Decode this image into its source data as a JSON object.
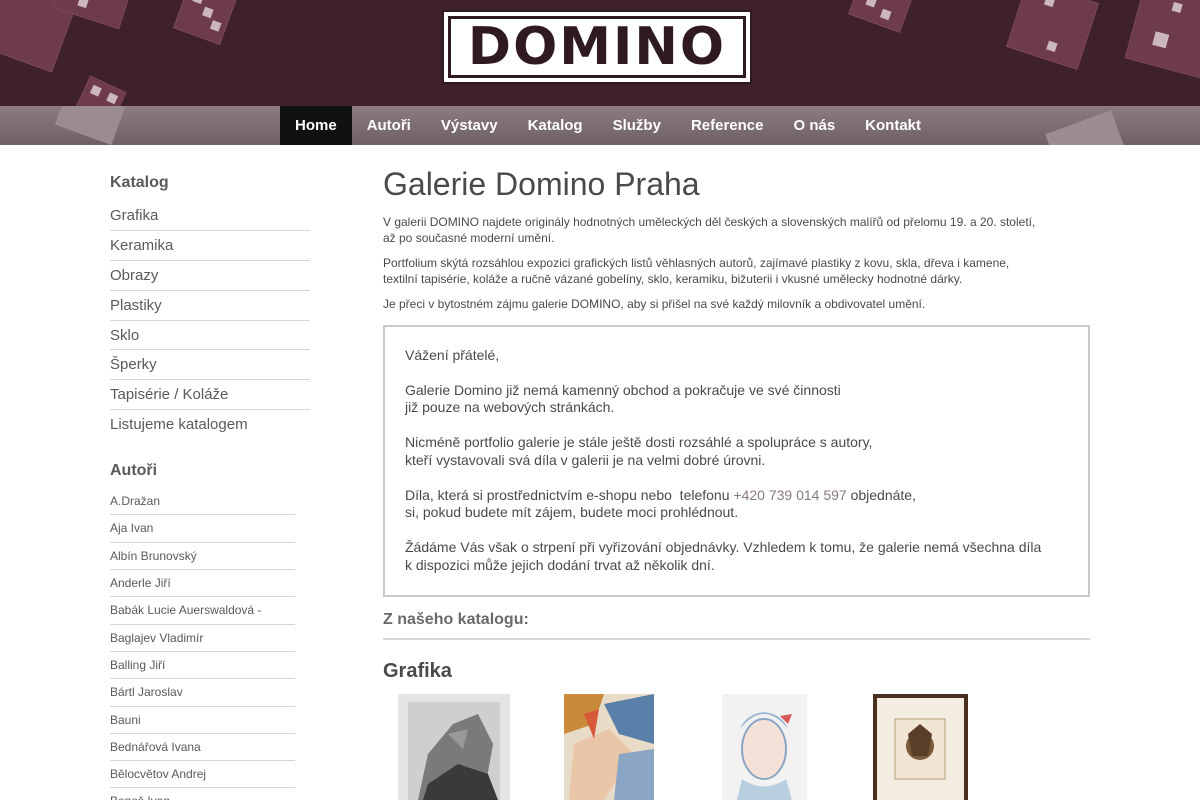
{
  "brand": {
    "logo_text": "DOMINO"
  },
  "nav": {
    "items": [
      {
        "label": "Home",
        "active": true
      },
      {
        "label": "Autoři"
      },
      {
        "label": "Výstavy"
      },
      {
        "label": "Katalog"
      },
      {
        "label": "Služby"
      },
      {
        "label": "Reference"
      },
      {
        "label": "O nás"
      },
      {
        "label": "Kontakt"
      }
    ]
  },
  "sidebar": {
    "catalog_heading": "Katalog",
    "catalog_items": [
      "Grafika",
      "Keramika",
      "Obrazy",
      "Plastiky",
      "Sklo",
      "Šperky",
      "Tapisérie / Koláže",
      "Listujeme katalogem"
    ],
    "authors_heading": "Autoři",
    "authors": [
      "A.Dražan",
      "Aja Ivan",
      "Albín Brunovský",
      "Anderle Jiří",
      "Babák Lucie Auerswaldová -",
      "Baglajev Vladimír",
      "Balling Jiří",
      "Bártl Jaroslav",
      "Bauni",
      "Bednářová Ivana",
      "Bělocvětov Andrej",
      "Beneš Ivan"
    ]
  },
  "main": {
    "title": "Galerie Domino Praha",
    "intro": [
      "V galerii DOMINO najdete originály hodnotných uměleckých děl českých a slovenských malířů od přelomu 19. a 20. století, až po současné moderní umění.",
      "Portfolium skýtá rozsáhlou expozici grafických listů věhlasných autorů, zajímavé plastiky z kovu, skla, dřeva i kamene, textilní tapisérie, koláže a ručně vázané gobelíny, sklo, keramiku, bižuterii i vkusné umělecky hodnotné dárky.",
      "Je přeci v bytostném zájmu galerie DOMINO, aby si přišel na své každý milovník a obdivovatel umění."
    ],
    "notice": {
      "greeting": "Vážení přátelé,",
      "p1_l1": "Galerie Domino již nemá kamenný obchod a pokračuje ve své činnosti",
      "p1_l2": "již pouze na webových stránkách.",
      "p2_l1": "Nicméně portfolio galerie je stále ještě dosti rozsáhlé a spolupráce s autory,",
      "p2_l2": "kteří vystavovali svá díla v galerii je na velmi dobré úrovni.",
      "p3_pre": "Díla, která si prostřednictvím e-shopu nebo  telefonu ",
      "p3_phone": "+420 739 014 597",
      "p3_post": " objednáte,",
      "p3_l2": "si, pokud budete mít zájem, budete moci prohlédnout.",
      "p4_l1": "Žádáme Vás však o strpení při vyřizování objednávky. Vzhledem k tomu, že galerie nemá všechna díla",
      "p4_l2": "k dispozici může jejich dodání trvat až několik dní."
    },
    "catalog_heading": "Z našeho katalogu:",
    "section_heading": "Grafika"
  },
  "colors": {
    "header_bg": "#3f2129",
    "nav_active": "#111111",
    "accent_phone": "#8a7a7e"
  }
}
